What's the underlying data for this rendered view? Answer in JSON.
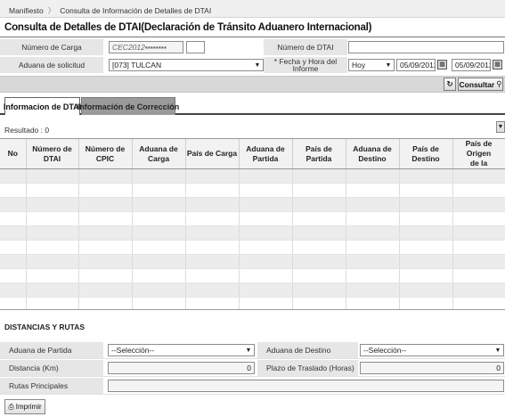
{
  "breadcrumb": {
    "items": [
      "Manifiesto",
      "Consulta de Información de Detalles de DTAI"
    ]
  },
  "page": {
    "title": "Consulta de Detalles de DTAI(Declaración de Tránsito Aduanero Internacional)"
  },
  "form": {
    "numero_carga": {
      "label": "Número de Carga",
      "value": "CEC2012▪▪▪▪▪▪▪▪",
      "suffix_value": ""
    },
    "numero_dtai": {
      "label": "Número de DTAI",
      "value": ""
    },
    "aduana_solicitud": {
      "label": "Aduana de solicitud",
      "value": "[073] TULCAN"
    },
    "fecha_hora": {
      "label_line1": "* Fecha y Hora del",
      "label_line2": "Informe",
      "period": "Hoy",
      "date_from": "05/09/2012",
      "date_to": "05/09/2012"
    }
  },
  "actions": {
    "consultar_label": "Consultar",
    "refresh_icon": "refresh-icon",
    "search_icon": "search-icon"
  },
  "tabs": [
    {
      "label": "Informacion de DTAI",
      "active": true
    },
    {
      "label": "Información de Corrección",
      "active": false
    }
  ],
  "results": {
    "label": "Resultado : 0",
    "columns": [
      [
        "No"
      ],
      [
        "Número de",
        "DTAI"
      ],
      [
        "Número de",
        "CPIC"
      ],
      [
        "Aduana de",
        "Carga"
      ],
      [
        "País de Carga"
      ],
      [
        "Aduana de",
        "Partida"
      ],
      [
        "País de",
        "Partida"
      ],
      [
        "Aduana de",
        "Destino"
      ],
      [
        "País de",
        "Destino"
      ],
      [
        "País de Origen",
        "de la"
      ]
    ],
    "empty_rows": 10
  },
  "distancias": {
    "title": "DISTANCIAS Y RUTAS",
    "aduana_partida": {
      "label": "Aduana de Partida",
      "value": "--Selección--"
    },
    "aduana_destino": {
      "label": "Aduana de Destino",
      "value": "--Selección--"
    },
    "distancia": {
      "label": "Distancia (Km)",
      "value": "0"
    },
    "plazo": {
      "label": "Plazo de Traslado (Horas)",
      "value": "0"
    },
    "rutas": {
      "label": "Rutas Principales",
      "value": ""
    }
  },
  "footer": {
    "print_label": "Imprimir"
  },
  "colors": {
    "label_bg": "#e6e6e6",
    "toolbar_bg": "#d8d8d8",
    "tab_inactive_bg": "#9a9a9a",
    "row_alt_bg": "#ececec"
  }
}
